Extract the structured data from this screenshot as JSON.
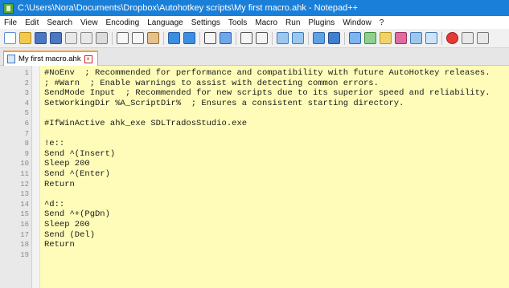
{
  "window": {
    "title": "C:\\Users\\Nora\\Documents\\Dropbox\\Autohotkey scripts\\My first macro.ahk - Notepad++"
  },
  "menu": [
    "File",
    "Edit",
    "Search",
    "View",
    "Encoding",
    "Language",
    "Settings",
    "Tools",
    "Macro",
    "Run",
    "Plugins",
    "Window",
    "?"
  ],
  "toolbar": {
    "icons": [
      "new-file-icon",
      "open-file-icon",
      "save-icon",
      "save-all-icon",
      "close-icon",
      "close-all-icon",
      "print-icon",
      "cut-icon",
      "copy-icon",
      "paste-icon",
      "undo-icon",
      "redo-icon",
      "find-icon",
      "replace-icon",
      "zoom-in-icon",
      "zoom-out-icon",
      "sync-vertical-icon",
      "sync-horizontal-icon",
      "word-wrap-icon",
      "show-all-chars-icon",
      "indent-guide-icon",
      "document-map-icon",
      "function-list-icon",
      "folder-workspace-icon",
      "monitor-icon",
      "eye-icon",
      "record-macro-icon",
      "stop-macro-icon",
      "play-macro-icon"
    ]
  },
  "tab": {
    "label": "My first macro.ahk"
  },
  "editor": {
    "lines": [
      {
        "n": "1",
        "text": "#NoEnv  ; Recommended for performance and compatibility with future AutoHotkey releases."
      },
      {
        "n": "2",
        "text": "; #Warn  ; Enable warnings to assist with detecting common errors."
      },
      {
        "n": "3",
        "text": "SendMode Input  ; Recommended for new scripts due to its superior speed and reliability."
      },
      {
        "n": "4",
        "text": "SetWorkingDir %A_ScriptDir%  ; Ensures a consistent starting directory."
      },
      {
        "n": "5",
        "text": ""
      },
      {
        "n": "6",
        "text": "#IfWinActive ahk_exe SDLTradosStudio.exe"
      },
      {
        "n": "7",
        "text": ""
      },
      {
        "n": "8",
        "text": "!e::"
      },
      {
        "n": "9",
        "text": "Send ^(Insert)"
      },
      {
        "n": "10",
        "text": "Sleep 200"
      },
      {
        "n": "11",
        "text": "Send ^(Enter)"
      },
      {
        "n": "12",
        "text": "Return"
      },
      {
        "n": "13",
        "text": ""
      },
      {
        "n": "14",
        "text": "^d::"
      },
      {
        "n": "15",
        "text": "Send ^+(PgDn)"
      },
      {
        "n": "16",
        "text": "Sleep 200"
      },
      {
        "n": "17",
        "text": "Send (Del)"
      },
      {
        "n": "18",
        "text": "Return"
      },
      {
        "n": "19",
        "text": ""
      }
    ]
  },
  "colors": {
    "titlebar": "#1a7fd8",
    "editor_background": "#fefcb8",
    "gutter_background": "#e9e9e9",
    "active_tab_accent": "#f59d3b"
  }
}
